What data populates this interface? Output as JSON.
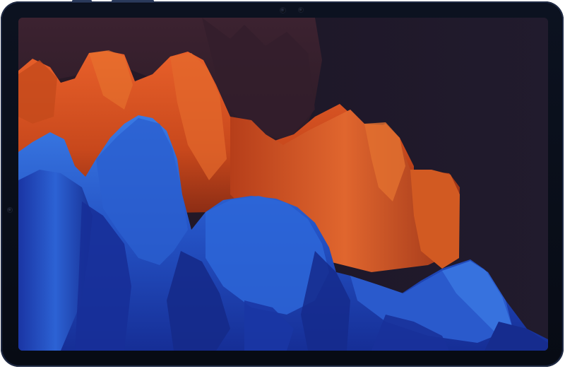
{
  "device": {
    "kind": "tablet",
    "frame_color": "#0b101c",
    "screen_state": "home-wallpaper"
  },
  "wallpaper": {
    "palette": {
      "background": "#1e1728",
      "background_right": "#221c2e",
      "shadow_plum": "#3a2332",
      "orange_dark": "#a8391a",
      "orange": "#d4521c",
      "orange_light": "#e8743a",
      "blue_dark": "#152a8c",
      "blue": "#2453c4",
      "blue_light": "#3a78e0"
    }
  },
  "icons": {
    "front_camera": "camera-icon",
    "camera_sensor": "sensor-icon",
    "side_camera": "camera-icon"
  }
}
